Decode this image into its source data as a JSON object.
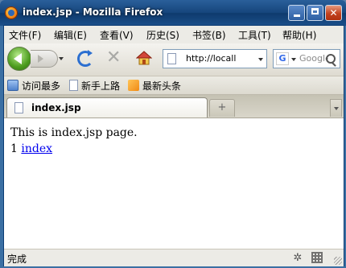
{
  "window": {
    "title": "index.jsp - Mozilla Firefox"
  },
  "menubar": {
    "items": [
      {
        "label": "文件(F)"
      },
      {
        "label": "编辑(E)"
      },
      {
        "label": "查看(V)"
      },
      {
        "label": "历史(S)"
      },
      {
        "label": "书签(B)"
      },
      {
        "label": "工具(T)"
      },
      {
        "label": "帮助(H)"
      }
    ]
  },
  "navbar": {
    "url": "http://locall",
    "search_placeholder": "Google",
    "search_engine_glyph": "G",
    "stop_glyph": "✕",
    "home_glyph": "⌂"
  },
  "bookmarks": {
    "items": [
      {
        "label": "访问最多",
        "icon": "most-visited-icon"
      },
      {
        "label": "新手上路",
        "icon": "page-icon"
      },
      {
        "label": "最新头条",
        "icon": "rss-icon"
      }
    ]
  },
  "tabs": {
    "active_label": "index.jsp",
    "new_tab_glyph": "+"
  },
  "content": {
    "line1": "This is index.jsp page.",
    "line2_prefix": "1",
    "link_text": "index"
  },
  "statusbar": {
    "text": "完成",
    "addon_glyph": "✲"
  },
  "colors": {
    "titlebar": "#16457c",
    "chrome": "#ecebe6",
    "link": "#0000ee",
    "back_button": "#4c9c1e",
    "reload": "#2c6fd0"
  }
}
